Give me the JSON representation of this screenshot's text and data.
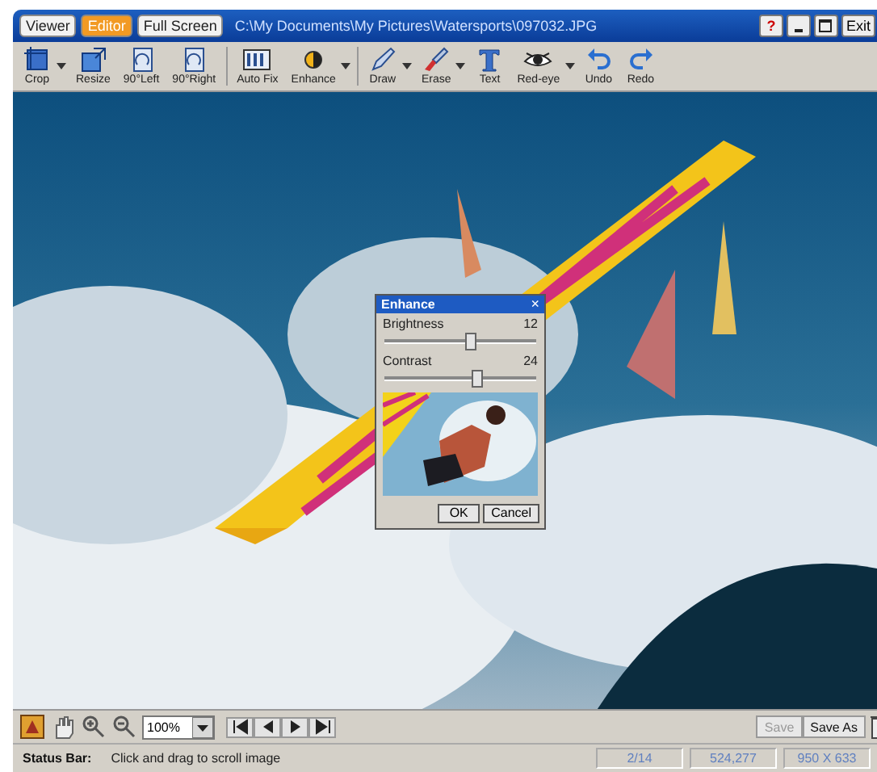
{
  "window": {
    "mode_tabs": [
      {
        "label": "Viewer",
        "selected": false
      },
      {
        "label": "Editor",
        "selected": true
      },
      {
        "label": "Full Screen",
        "selected": false
      }
    ],
    "path": "C:\\My Documents\\My Pictures\\Watersports\\097032.JPG",
    "controls": [
      {
        "kind": "help",
        "label": "?"
      },
      {
        "kind": "minimize"
      },
      {
        "kind": "maximize"
      },
      {
        "kind": "exit",
        "label": "Exit"
      }
    ]
  },
  "toolbar": [
    {
      "label": "Crop",
      "dropdown": true
    },
    {
      "label": "Resize",
      "dropdown": false
    },
    {
      "label": "90°Left",
      "dropdown": false
    },
    {
      "label": "90°Right",
      "dropdown": false
    },
    {
      "label": "Auto Fix",
      "dropdown": false
    },
    {
      "label": "Enhance",
      "dropdown": true
    },
    {
      "label": "Draw",
      "dropdown": true
    },
    {
      "label": "Erase",
      "dropdown": true
    },
    {
      "label": "Text",
      "dropdown": false
    },
    {
      "label": "Red-eye",
      "dropdown": true
    },
    {
      "label": "Undo",
      "dropdown": false
    },
    {
      "label": "Redo",
      "dropdown": false
    }
  ],
  "dialog": {
    "title": "Enhance",
    "close": "×",
    "sliders": [
      {
        "label": "Brightness",
        "value": "12",
        "level": 0.55
      },
      {
        "label": "Contrast",
        "value": "24",
        "level": 0.6
      }
    ],
    "preview": {
      "kind": "picture"
    },
    "buttons": [
      "OK",
      "Cancel"
    ]
  },
  "bottom_toolbar": {
    "zoom": "100%",
    "buttons": [
      {
        "label": "Save",
        "disabled": true
      },
      {
        "label": "Save As",
        "disabled": false
      }
    ]
  },
  "status_bar": {
    "label": "Status Bar:",
    "message": "Click and drag to scroll image",
    "fields": [
      "2/14",
      "524,277",
      "950 X 633"
    ]
  }
}
